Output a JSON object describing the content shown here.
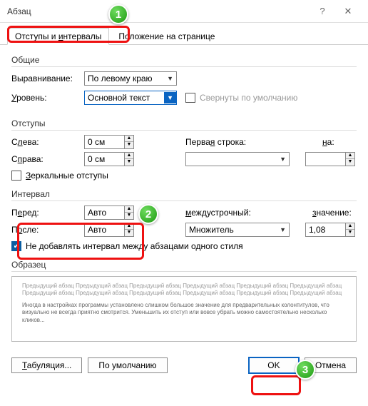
{
  "title": "Абзац",
  "tabs": {
    "indents": "Отступы и интервалы",
    "position": "Положение на странице"
  },
  "general": {
    "title": "Общие",
    "align_label": "Выравнивание:",
    "align_value": "По левому краю",
    "level_label": "Уровень:",
    "level_value": "Основной текст",
    "collapse_label": "Свернуты по умолчанию"
  },
  "indent": {
    "title": "Отступы",
    "left_label": "Слева:",
    "left_value": "0 см",
    "right_label": "Справа:",
    "right_value": "0 см",
    "firstline_label": "Первая строка:",
    "firstline_value": "",
    "by_label": "на:",
    "by_value": "",
    "mirror_label": "Зеркальные отступы"
  },
  "spacing": {
    "title": "Интервал",
    "before_label": "Перед:",
    "before_value": "Авто",
    "after_label": "После:",
    "after_value": "Авто",
    "line_label": "междустрочный:",
    "line_value": "Множитель",
    "at_label": "значение:",
    "at_value": "1,08",
    "sameStyle_label": "Не добавлять интервал между абзацами одного стиля"
  },
  "preview": {
    "title": "Образец",
    "text1": "Предыдущий абзац Предыдущий абзац Предыдущий абзац Предыдущий абзац Предыдущий абзац Предыдущий абзац Предыдущий абзац Предыдущий абзац Предыдущий абзац Предыдущий абзац Предыдущий абзац Предыдущий абзац",
    "text2": "Иногда в настройках программы установлено слишком большое значение для предварительных колонтитулов, что визуально не всегда приятно смотрится. Уменьшить их отступ или вовсе убрать можно самостоятельно несколько кликов..."
  },
  "footer": {
    "tabs_btn": "Табуляция...",
    "default_btn": "По умолчанию",
    "ok": "OK",
    "cancel": "Отмена"
  },
  "badges": {
    "b1": "1",
    "b2": "2",
    "b3": "3"
  }
}
